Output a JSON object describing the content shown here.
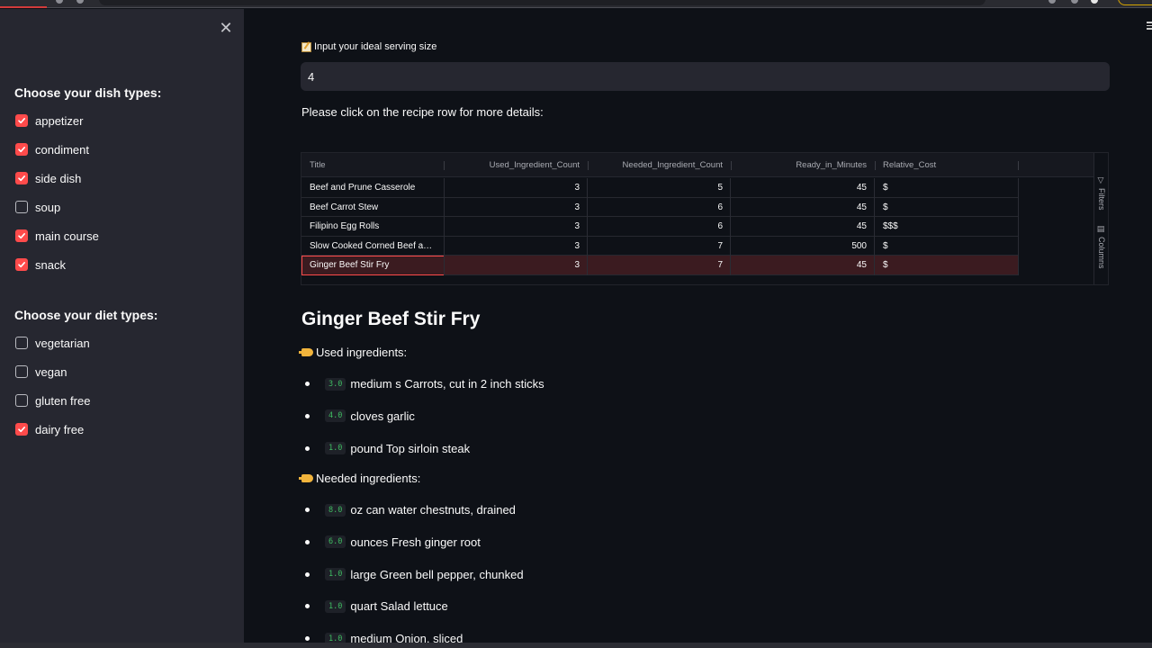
{
  "sidebar": {
    "close_icon": "close-icon",
    "dish_title": "Choose your dish types:",
    "dish_types": [
      {
        "label": "appetizer",
        "checked": true
      },
      {
        "label": "condiment",
        "checked": true
      },
      {
        "label": "side dish",
        "checked": true
      },
      {
        "label": "soup",
        "checked": false
      },
      {
        "label": "main course",
        "checked": true
      },
      {
        "label": "snack",
        "checked": true
      }
    ],
    "diet_title": "Choose your diet types:",
    "diet_types": [
      {
        "label": "vegetarian",
        "checked": false
      },
      {
        "label": "vegan",
        "checked": false
      },
      {
        "label": "gluten free",
        "checked": false
      },
      {
        "label": "dairy free",
        "checked": true
      }
    ]
  },
  "main": {
    "serving_label": "Input your ideal serving size",
    "serving_value": "4",
    "instruction": "Please click on the recipe row for more details:",
    "table": {
      "columns": [
        "Title",
        "Used_Ingredient_Count",
        "Needed_Ingredient_Count",
        "Ready_in_Minutes",
        "Relative_Cost"
      ],
      "rows": [
        [
          "Beef and Prune Casserole",
          "3",
          "5",
          "45",
          "$"
        ],
        [
          "Beef Carrot Stew",
          "3",
          "6",
          "45",
          "$"
        ],
        [
          "Filipino Egg Rolls",
          "3",
          "6",
          "45",
          "$$$"
        ],
        [
          "Slow Cooked Corned Beef a…",
          "3",
          "7",
          "500",
          "$"
        ],
        [
          "Ginger Beef Stir Fry",
          "3",
          "7",
          "45",
          "$"
        ]
      ],
      "selected_row": 4,
      "side_tabs": [
        "Filters",
        "Columns"
      ]
    },
    "recipe_title": "Ginger Beef Stir Fry",
    "used_heading": "Used ingredients:",
    "used_ingredients": [
      {
        "amount": "3.0",
        "text": "medium s Carrots, cut in 2 inch sticks"
      },
      {
        "amount": "4.0",
        "text": "cloves garlic"
      },
      {
        "amount": "1.0",
        "text": "pound Top sirloin steak"
      }
    ],
    "needed_heading": "Needed ingredients:",
    "needed_ingredients": [
      {
        "amount": "8.0",
        "text": "oz can water chestnuts, drained"
      },
      {
        "amount": "6.0",
        "text": "ounces Fresh ginger root"
      },
      {
        "amount": "1.0",
        "text": "large Green bell pepper, chunked"
      },
      {
        "amount": "1.0",
        "text": "quart Salad lettuce"
      },
      {
        "amount": "1.0",
        "text": "medium Onion, sliced"
      }
    ]
  },
  "colors": {
    "accent": "#ff4b4b",
    "sidebar_bg": "#262730",
    "main_bg": "#0e1117",
    "amount_text": "#3fbc62"
  }
}
